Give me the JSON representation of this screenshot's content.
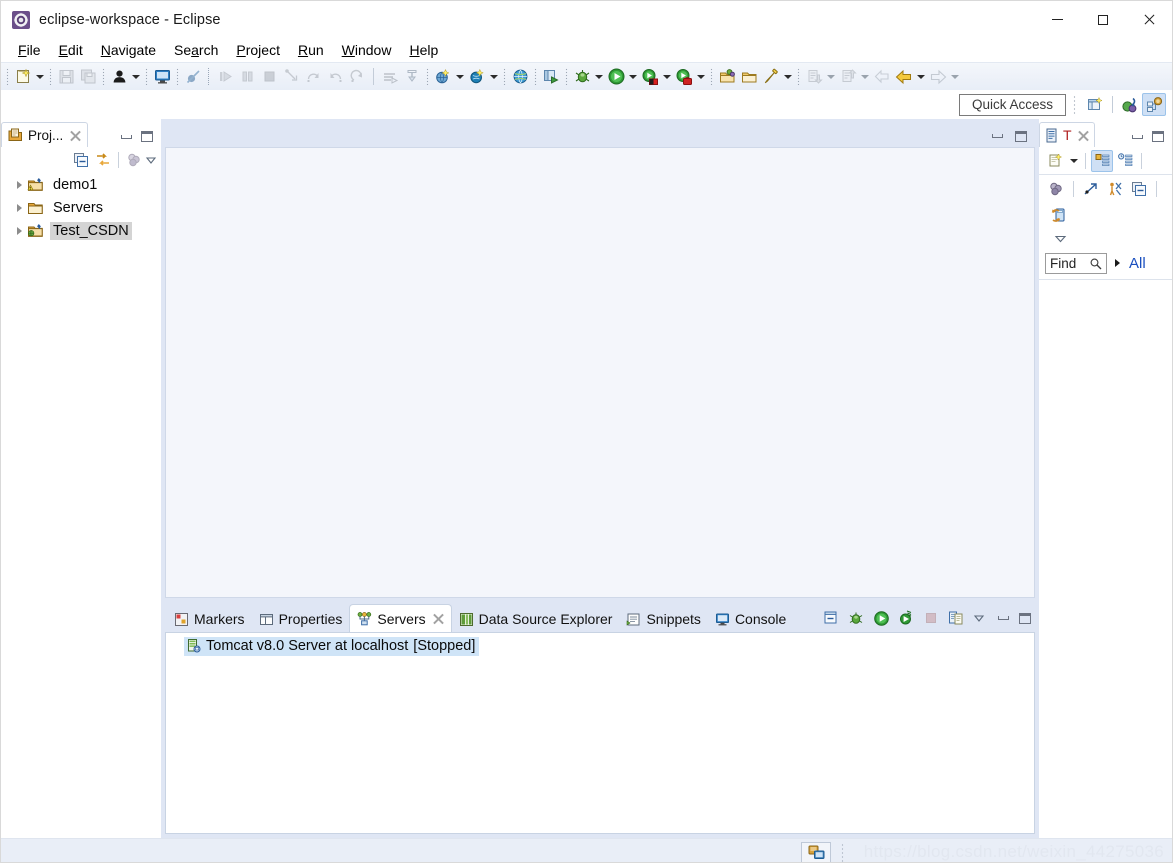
{
  "window": {
    "title": "eclipse-workspace - Eclipse",
    "app_icon": "eclipse-icon",
    "controls": {
      "minimize": "minimize-icon",
      "maximize": "maximize-icon",
      "close": "close-icon"
    }
  },
  "menubar": {
    "items": [
      {
        "mnemonic": "F",
        "rest": "ile",
        "name": "file"
      },
      {
        "mnemonic": "E",
        "rest": "dit",
        "name": "edit"
      },
      {
        "mnemonic": "N",
        "rest": "avigate",
        "name": "navigate"
      },
      {
        "pre": "Se",
        "mnemonic": "a",
        "rest": "rch",
        "name": "search"
      },
      {
        "mnemonic": "P",
        "rest": "roject",
        "name": "project"
      },
      {
        "mnemonic": "R",
        "rest": "un",
        "name": "run"
      },
      {
        "mnemonic": "W",
        "rest": "indow",
        "name": "window"
      },
      {
        "mnemonic": "H",
        "rest": "elp",
        "name": "help"
      }
    ]
  },
  "toolbar": {
    "groups": [
      {
        "items": [
          {
            "icon": "new-wizard-icon",
            "enabled": true,
            "dropdown": true
          },
          {
            "icon": "save-icon",
            "enabled": false
          },
          {
            "icon": "save-all-icon",
            "enabled": false
          }
        ]
      },
      {
        "items": [
          {
            "icon": "user-account-icon",
            "enabled": true,
            "dropdown": true
          }
        ]
      },
      {
        "items": [
          {
            "icon": "terminal-icon",
            "enabled": true
          }
        ]
      },
      {
        "items": [
          {
            "icon": "no-breakpoint-icon",
            "enabled": false
          }
        ]
      },
      {
        "items": [
          {
            "icon": "resume-icon",
            "enabled": false
          },
          {
            "icon": "suspend-icon",
            "enabled": false
          },
          {
            "icon": "terminate-icon",
            "enabled": false
          },
          {
            "icon": "step-into-icon",
            "enabled": false
          },
          {
            "icon": "step-over-icon",
            "enabled": false
          },
          {
            "icon": "step-return-icon",
            "enabled": false
          },
          {
            "icon": "drop-to-frame-icon",
            "enabled": false
          }
        ]
      },
      {
        "items": [
          {
            "icon": "publish-icon",
            "enabled": false
          },
          {
            "icon": "publish-all-icon",
            "enabled": false
          }
        ]
      },
      {
        "items": [
          {
            "icon": "new-jsp-icon",
            "enabled": true,
            "dropdown": true
          },
          {
            "icon": "new-server-icon",
            "enabled": true,
            "dropdown": true
          }
        ]
      },
      {
        "items": [
          {
            "icon": "open-web-browser-icon",
            "enabled": true
          }
        ]
      },
      {
        "items": [
          {
            "icon": "open-perspective-run-icon",
            "enabled": true
          }
        ]
      },
      {
        "items": [
          {
            "icon": "debug-icon",
            "enabled": true,
            "dropdown": true
          },
          {
            "icon": "run-icon",
            "enabled": true,
            "dropdown": true
          },
          {
            "icon": "run-external-tools-icon",
            "enabled": true,
            "dropdown": true
          },
          {
            "icon": "profile-icon",
            "enabled": true,
            "dropdown": true
          }
        ]
      },
      {
        "items": [
          {
            "icon": "open-type-icon",
            "enabled": true
          },
          {
            "icon": "open-task-icon",
            "enabled": true
          },
          {
            "icon": "search-icon",
            "enabled": true,
            "dropdown": true
          }
        ]
      },
      {
        "items": [
          {
            "icon": "next-annotation-icon",
            "enabled": false,
            "dropdown": true
          },
          {
            "icon": "previous-annotation-icon",
            "enabled": false,
            "dropdown": true
          }
        ]
      },
      {
        "items": [
          {
            "icon": "back-history-icon",
            "enabled": false
          },
          {
            "icon": "back-icon",
            "enabled": true,
            "dropdown": true
          },
          {
            "icon": "forward-icon",
            "enabled": false,
            "dropdown": true
          }
        ]
      }
    ]
  },
  "quick_access": {
    "placeholder": "Quick Access",
    "value": "",
    "open_perspective_icon": "open-perspective-icon",
    "perspectives": [
      {
        "name": "java-ee-perspective",
        "icon": "java-ee-icon",
        "active": false
      },
      {
        "name": "java-perspective",
        "icon": "web-perspective-icon",
        "active": true
      }
    ]
  },
  "project_explorer": {
    "tab_label": "Proj...",
    "tab_icon": "project-explorer-icon",
    "close_icon": "close-icon",
    "minimize_icon": "minimize-view-icon",
    "maximize_icon": "maximize-view-icon",
    "toolbar": [
      {
        "icon": "collapse-all-icon",
        "name": "collapse-all"
      },
      {
        "icon": "link-with-editor-icon",
        "name": "link-with-editor"
      },
      {
        "icon": "view-menu-filter-icon",
        "name": "filters"
      },
      {
        "icon": "view-menu-icon",
        "name": "view-menu"
      }
    ],
    "tree": [
      {
        "label": "demo1",
        "icon": "dynamic-web-project-warning-icon",
        "expanded": false,
        "selected": false
      },
      {
        "label": "Servers",
        "icon": "folder-icon",
        "expanded": false,
        "selected": false
      },
      {
        "label": "Test_CSDN",
        "icon": "dynamic-web-project-icon",
        "expanded": false,
        "selected": true
      }
    ]
  },
  "editor_area": {
    "minimize_icon": "minimize-view-icon",
    "maximize_icon": "maximize-view-icon",
    "open_editors": []
  },
  "bottom_panel": {
    "tabs": [
      {
        "label": "Markers",
        "icon": "markers-icon",
        "active": false,
        "closeable": false
      },
      {
        "label": "Properties",
        "icon": "properties-icon",
        "active": false,
        "closeable": false
      },
      {
        "label": "Servers",
        "icon": "servers-icon",
        "active": true,
        "closeable": true
      },
      {
        "label": "Data Source Explorer",
        "icon": "data-source-explorer-icon",
        "active": false,
        "closeable": false
      },
      {
        "label": "Snippets",
        "icon": "snippets-icon",
        "active": false,
        "closeable": false
      },
      {
        "label": "Console",
        "icon": "console-icon",
        "active": false,
        "closeable": false
      }
    ],
    "toolbar": [
      {
        "icon": "new-server-view-icon",
        "name": "new-server"
      },
      {
        "icon": "debug-server-icon",
        "name": "debug"
      },
      {
        "icon": "start-server-icon",
        "name": "start"
      },
      {
        "icon": "profile-server-icon",
        "name": "profile"
      },
      {
        "icon": "stop-server-icon",
        "name": "stop"
      },
      {
        "icon": "publish-server-icon",
        "name": "publish"
      },
      {
        "icon": "view-menu-icon",
        "name": "view-menu"
      },
      {
        "icon": "minimize-view-icon",
        "name": "minimize"
      },
      {
        "icon": "maximize-view-icon",
        "name": "maximize"
      }
    ],
    "servers": [
      {
        "name": "Tomcat v8.0 Server at localhost",
        "state": "[Stopped]",
        "icon": "tomcat-server-icon",
        "selected": true
      }
    ]
  },
  "task_list": {
    "tab_label": "T",
    "tab_icon": "task-list-icon",
    "close_icon": "close-icon",
    "minimize_icon": "minimize-view-icon",
    "maximize_icon": "maximize-view-icon",
    "toolbar_row1": [
      {
        "icon": "new-task-icon",
        "name": "new-task",
        "dropdown": true
      },
      {
        "icon": "categorized-presentation-icon",
        "name": "categorized-presentation",
        "active": true
      },
      {
        "icon": "scheduled-presentation-icon",
        "name": "scheduled-presentation",
        "active": false
      }
    ],
    "toolbar_row2": [
      {
        "icon": "filter-icon",
        "name": "filters"
      },
      {
        "icon": "focus-on-workweek-icon",
        "name": "focus-on-workweek"
      },
      {
        "icon": "synchronize-changed-icon",
        "name": "synchronize-changed"
      },
      {
        "icon": "collapse-all-icon",
        "name": "collapse-all"
      }
    ],
    "toolbar_row3": [
      {
        "icon": "synchronize-icon",
        "name": "synchronize"
      }
    ],
    "toolbar_row4": [
      {
        "icon": "view-menu-icon",
        "name": "view-menu"
      }
    ],
    "find": {
      "label": "Find",
      "icon": "search-icon",
      "value": "",
      "scope_expand_icon": "chevron-right-icon",
      "scope_label": "All"
    }
  },
  "status_bar": {
    "icon": "server-status-icon",
    "watermark": "https://blog.csdn.net/weixin_44275036"
  },
  "colors": {
    "chrome": "#dfe6f4",
    "toolbar_gradient_top": "#f4f7fb",
    "accent_blue": "#1a4fbf",
    "selection_gray": "#d4d4d4",
    "selection_blue": "#cfe4f7",
    "tab_red": "#b02020",
    "watermark": "#e2e7f0"
  }
}
